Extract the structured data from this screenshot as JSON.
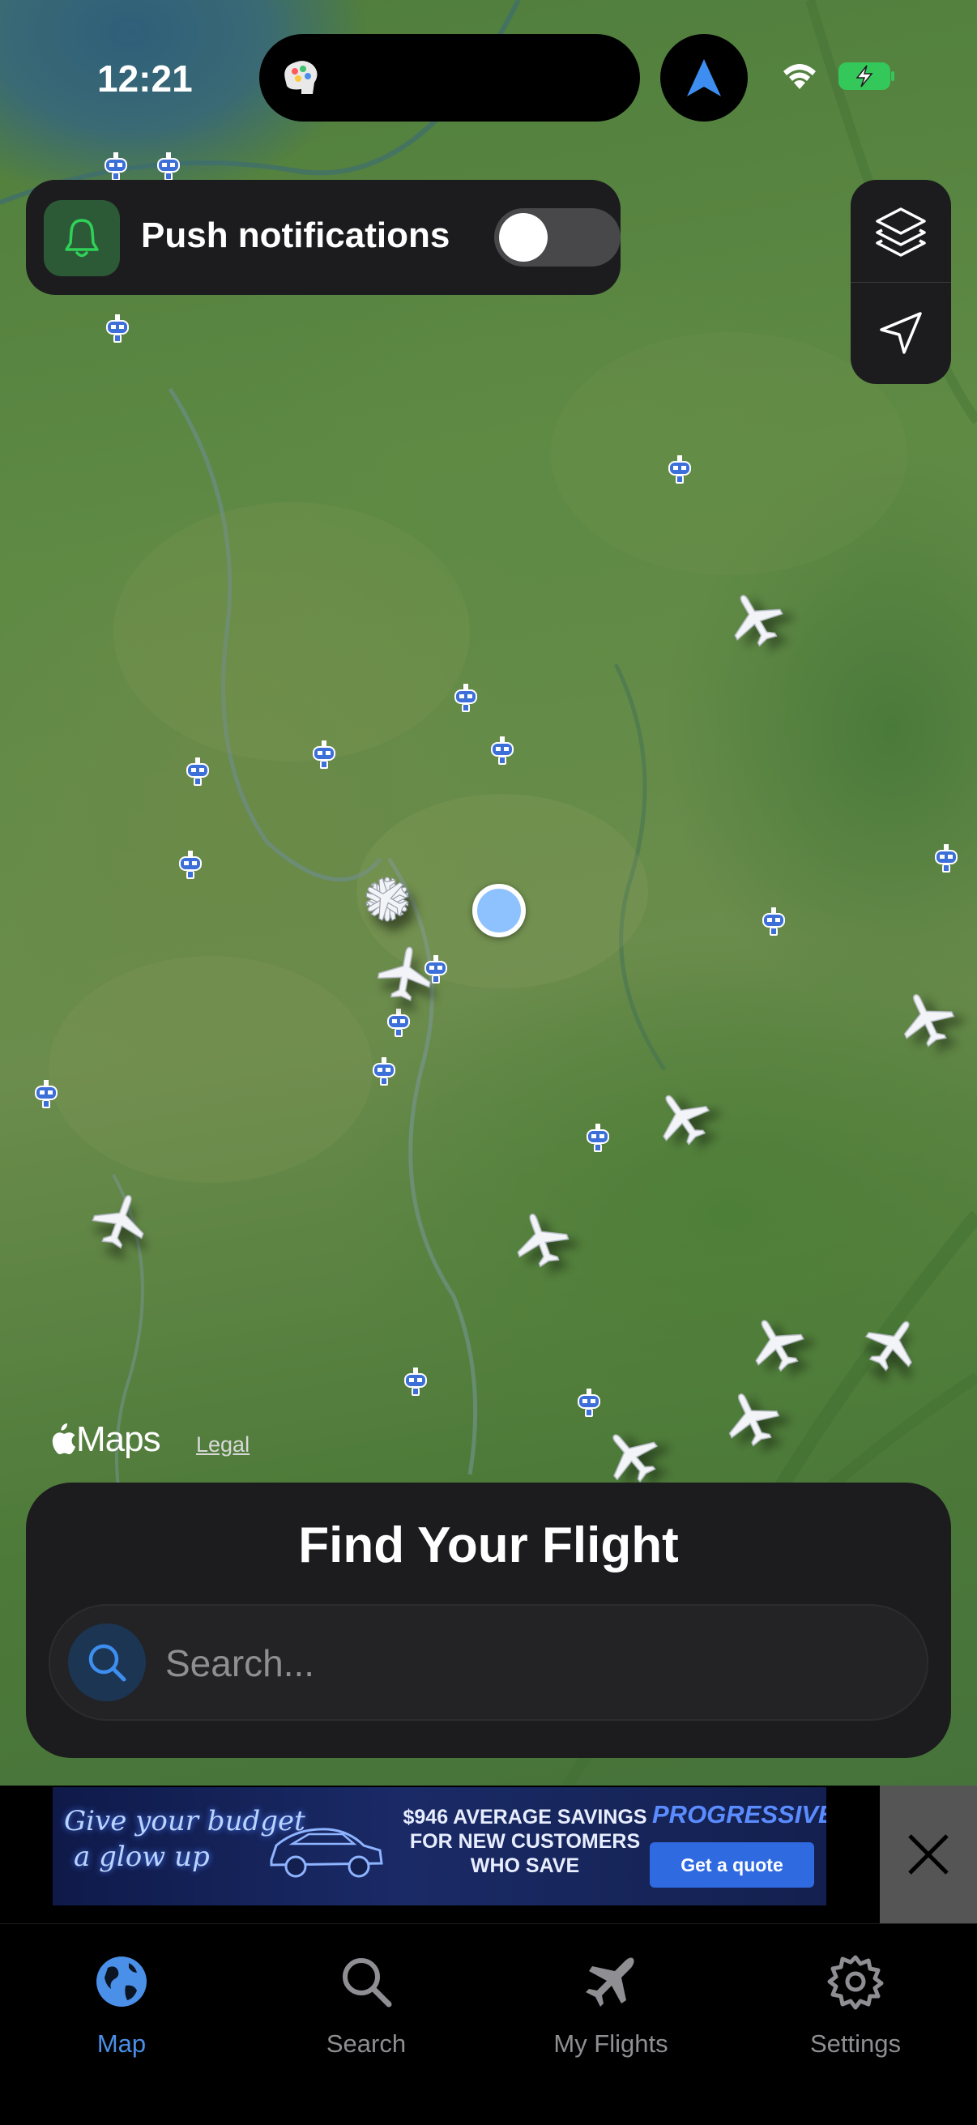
{
  "status_bar": {
    "time": "12:21"
  },
  "push": {
    "label": "Push notifications",
    "enabled": false
  },
  "map": {
    "attribution": "Maps",
    "legal": "Legal"
  },
  "find_flight": {
    "title": "Find Your Flight",
    "search_placeholder": "Search..."
  },
  "ad": {
    "tagline_line1": "Give your budget",
    "tagline_line2": "a glow up",
    "savings_line1": "$946 AVERAGE SAVINGS",
    "savings_line2": "FOR NEW CUSTOMERS",
    "savings_line3": "WHO SAVE",
    "brand": "PROGRESSIVE",
    "cta": "Get a quote"
  },
  "tabs": [
    {
      "label": "Map",
      "icon": "globe-icon",
      "active": true
    },
    {
      "label": "Search",
      "icon": "search-icon",
      "active": false
    },
    {
      "label": "My Flights",
      "icon": "airplane-icon",
      "active": false
    },
    {
      "label": "Settings",
      "icon": "gear-icon",
      "active": false
    }
  ],
  "colors": {
    "accent": "#4a8fe8",
    "airport_marker": "#3d6fd8",
    "card_bg": "#1c1c1e",
    "bell_green": "#30d158"
  }
}
